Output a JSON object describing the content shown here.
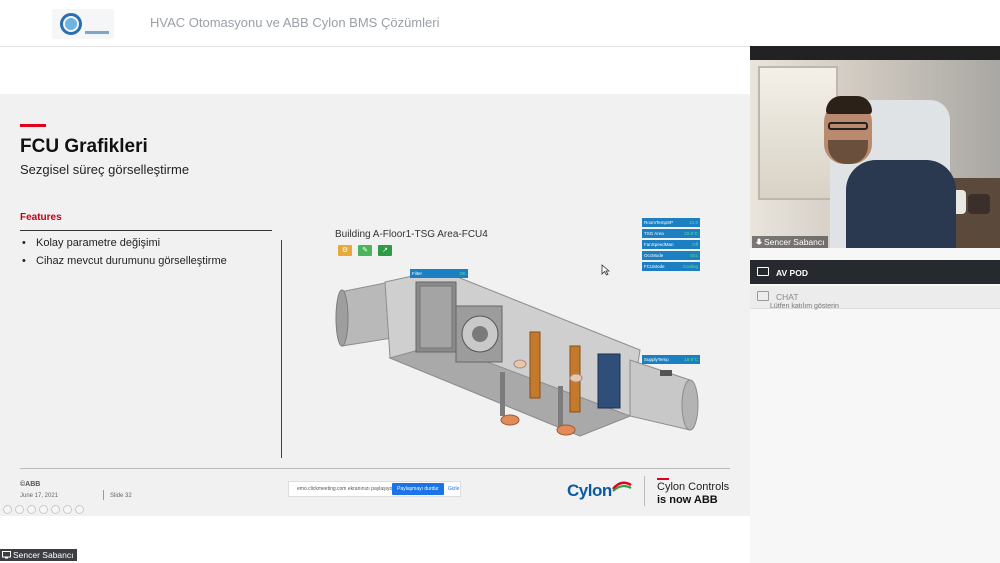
{
  "meeting": {
    "title": "HVAC Otomasyonu ve ABB Cylon BMS Çözümleri"
  },
  "slide": {
    "title": "FCU Grafikleri",
    "subtitle": "Sezgisel süreç görselleştirme",
    "features_label": "Features",
    "bullets": [
      "Kolay parametre değişimi",
      "Cihaz mevcut durumunu görselleştirme"
    ],
    "graphic_title": "Building A-Floor1-TSG Area-FCU4",
    "status_rows": [
      {
        "label": "RoomTempSP",
        "value": "21.0"
      },
      {
        "label": "TSG Area",
        "value": "22.6°C"
      },
      {
        "label": "FanSpeedMan",
        "value": "Off"
      },
      {
        "label": "OccMode",
        "value": "Occ"
      },
      {
        "label": "FCUMode",
        "value": "Cooling"
      }
    ],
    "filter_tag": {
      "label": "Filter",
      "value": "OK"
    },
    "supply_tag": {
      "label": "SupplyTemp",
      "value": "18.9°C"
    },
    "copyright": "©ABB",
    "date": "June 17, 2021",
    "slide_number": "Slide 32",
    "brand_name": "Cylon",
    "brand_line1": "Cylon Controls",
    "brand_line2": "is now ABB"
  },
  "share_bar": {
    "text": "emo.clickmeeting.com ekranınızı paylaşıyor.",
    "stop_label": "Paylaşmayı durdur",
    "hide_label": "Gizle"
  },
  "presenter_label": "Sencer Sabancı",
  "right_panel": {
    "video_name": "Sencer Sabancı",
    "avpod_label": "AV POD",
    "chat_label": "CHAT",
    "chat_snippet": "Lütfen katılım gösterin"
  },
  "colors": {
    "accent_red": "#e2001a",
    "status_blue": "#1b7fc2",
    "cylon_blue": "#0b5aa6"
  }
}
